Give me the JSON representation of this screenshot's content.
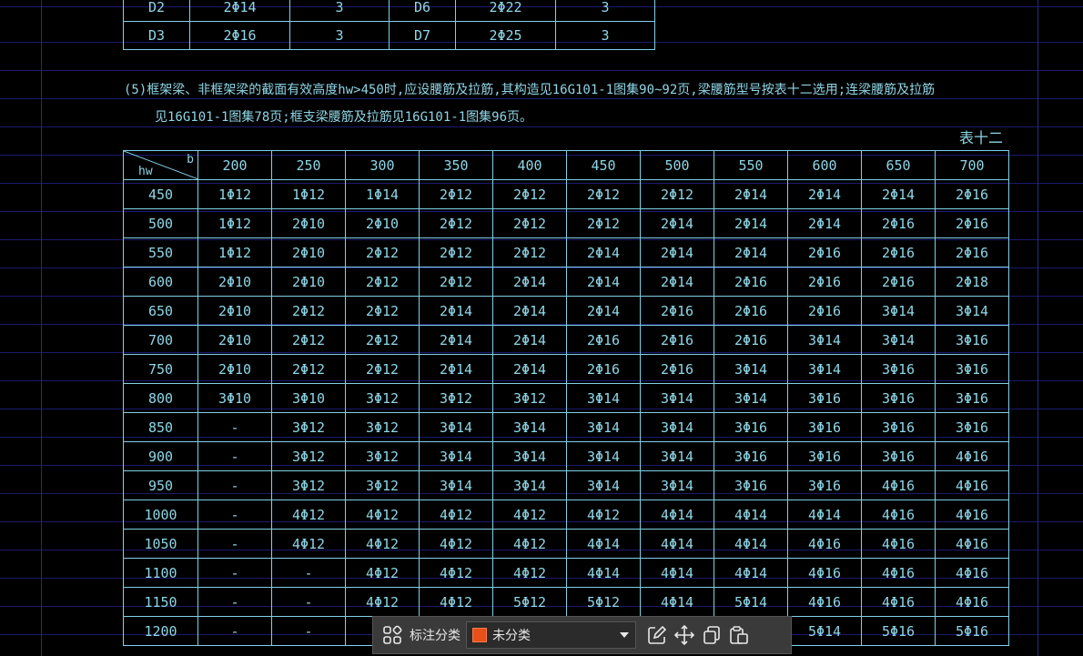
{
  "top_table": {
    "rows": [
      [
        "D2",
        "2Φ14",
        "3",
        "D6",
        "2Φ22",
        "3"
      ],
      [
        "D3",
        "2Φ16",
        "3",
        "D7",
        "2Φ25",
        "3"
      ]
    ]
  },
  "notes": {
    "line1": "(5)框架梁、非框架梁的截面有效高度hw>450时,应设腰筋及拉筋,其构造见16G101-1图集90~92页,梁腰筋型号按表十二选用;连梁腰筋及拉筋",
    "line2": "见16G101-1图集78页;框支梁腰筋及拉筋见16G101-1图集96页。"
  },
  "table_label": "表十二",
  "main_table": {
    "corner_row_label": "hw",
    "corner_col_label": "b",
    "columns": [
      "200",
      "250",
      "300",
      "350",
      "400",
      "450",
      "500",
      "550",
      "600",
      "650",
      "700"
    ],
    "rows": [
      {
        "hw": "450",
        "cells": [
          "1Φ12",
          "1Φ12",
          "1Φ14",
          "2Φ12",
          "2Φ12",
          "2Φ12",
          "2Φ12",
          "2Φ14",
          "2Φ14",
          "2Φ14",
          "2Φ16"
        ]
      },
      {
        "hw": "500",
        "cells": [
          "1Φ12",
          "2Φ10",
          "2Φ10",
          "2Φ12",
          "2Φ12",
          "2Φ12",
          "2Φ14",
          "2Φ14",
          "2Φ14",
          "2Φ16",
          "2Φ16"
        ]
      },
      {
        "hw": "550",
        "cells": [
          "1Φ12",
          "2Φ10",
          "2Φ12",
          "2Φ12",
          "2Φ12",
          "2Φ14",
          "2Φ14",
          "2Φ14",
          "2Φ16",
          "2Φ16",
          "2Φ16"
        ]
      },
      {
        "hw": "600",
        "cells": [
          "2Φ10",
          "2Φ10",
          "2Φ12",
          "2Φ12",
          "2Φ14",
          "2Φ14",
          "2Φ14",
          "2Φ16",
          "2Φ16",
          "2Φ16",
          "2Φ18"
        ]
      },
      {
        "hw": "650",
        "cells": [
          "2Φ10",
          "2Φ12",
          "2Φ12",
          "2Φ14",
          "2Φ14",
          "2Φ14",
          "2Φ16",
          "2Φ16",
          "2Φ16",
          "3Φ14",
          "3Φ14"
        ]
      },
      {
        "hw": "700",
        "cells": [
          "2Φ10",
          "2Φ12",
          "2Φ12",
          "2Φ14",
          "2Φ14",
          "2Φ16",
          "2Φ16",
          "2Φ16",
          "3Φ14",
          "3Φ14",
          "3Φ16"
        ]
      },
      {
        "hw": "750",
        "cells": [
          "2Φ10",
          "2Φ12",
          "2Φ12",
          "2Φ14",
          "2Φ14",
          "2Φ16",
          "2Φ16",
          "3Φ14",
          "3Φ14",
          "3Φ16",
          "3Φ16"
        ]
      },
      {
        "hw": "800",
        "cells": [
          "3Φ10",
          "3Φ10",
          "3Φ12",
          "3Φ12",
          "3Φ12",
          "3Φ14",
          "3Φ14",
          "3Φ14",
          "3Φ16",
          "3Φ16",
          "3Φ16"
        ]
      },
      {
        "hw": "850",
        "cells": [
          "-",
          "3Φ12",
          "3Φ12",
          "3Φ14",
          "3Φ14",
          "3Φ14",
          "3Φ14",
          "3Φ16",
          "3Φ16",
          "3Φ16",
          "3Φ16"
        ]
      },
      {
        "hw": "900",
        "cells": [
          "-",
          "3Φ12",
          "3Φ12",
          "3Φ14",
          "3Φ14",
          "3Φ14",
          "3Φ14",
          "3Φ16",
          "3Φ16",
          "3Φ16",
          "4Φ16"
        ]
      },
      {
        "hw": "950",
        "cells": [
          "-",
          "3Φ12",
          "3Φ12",
          "3Φ14",
          "3Φ14",
          "3Φ14",
          "3Φ14",
          "3Φ16",
          "3Φ16",
          "4Φ16",
          "4Φ16"
        ]
      },
      {
        "hw": "1000",
        "cells": [
          "-",
          "4Φ12",
          "4Φ12",
          "4Φ12",
          "4Φ12",
          "4Φ12",
          "4Φ14",
          "4Φ14",
          "4Φ14",
          "4Φ16",
          "4Φ16"
        ]
      },
      {
        "hw": "1050",
        "cells": [
          "-",
          "4Φ12",
          "4Φ12",
          "4Φ12",
          "4Φ12",
          "4Φ14",
          "4Φ14",
          "4Φ14",
          "4Φ16",
          "4Φ16",
          "4Φ16"
        ]
      },
      {
        "hw": "1100",
        "cells": [
          "-",
          "-",
          "4Φ12",
          "4Φ12",
          "4Φ12",
          "4Φ14",
          "4Φ14",
          "4Φ14",
          "4Φ16",
          "4Φ16",
          "4Φ16"
        ]
      },
      {
        "hw": "1150",
        "cells": [
          "-",
          "-",
          "4Φ12",
          "4Φ12",
          "5Φ12",
          "5Φ12",
          "4Φ14",
          "5Φ14",
          "4Φ16",
          "4Φ16",
          "4Φ16"
        ]
      },
      {
        "hw": "1200",
        "cells": [
          "-",
          "-",
          "5",
          "",
          "",
          "",
          "",
          "",
          "5Φ14",
          "5Φ16",
          "5Φ16"
        ]
      }
    ]
  },
  "toolbar": {
    "label": "标注分类",
    "selected": "未分类",
    "swatch_color": "#e8501a",
    "icons": [
      "grid-icon",
      "edit-note-icon",
      "move-icon",
      "copy-icon",
      "paste-icon"
    ]
  }
}
